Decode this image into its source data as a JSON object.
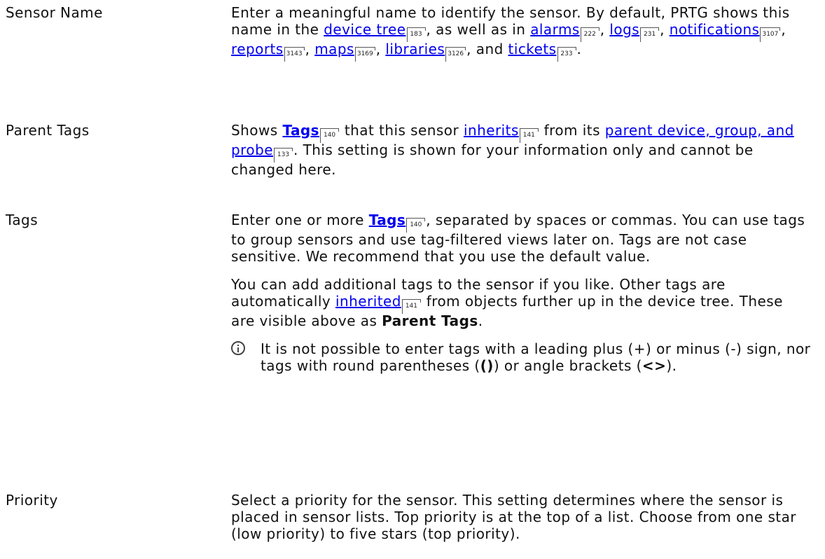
{
  "settings": [
    {
      "label": "Sensor Name",
      "paragraphs": [
        {
          "segments": [
            {
              "t": "Enter a meaningful name to identify the sensor. By default, PRTG shows this name in the "
            },
            {
              "t": "device tree",
              "link": true,
              "page": "183"
            },
            {
              "t": ", as well as in "
            },
            {
              "t": "alarms",
              "link": true,
              "page": "222"
            },
            {
              "t": ", "
            },
            {
              "t": "logs",
              "link": true,
              "page": "231"
            },
            {
              "t": ", "
            },
            {
              "t": "notifications",
              "link": true,
              "page": "3107"
            },
            {
              "t": ", "
            },
            {
              "t": "reports",
              "link": true,
              "page": "3143"
            },
            {
              "t": ", "
            },
            {
              "t": "maps",
              "link": true,
              "page": "3169"
            },
            {
              "t": ", "
            },
            {
              "t": "libraries",
              "link": true,
              "page": "3126"
            },
            {
              "t": ", and "
            },
            {
              "t": "tickets",
              "link": true,
              "page": "233"
            },
            {
              "t": "."
            }
          ]
        }
      ]
    },
    {
      "label": "Parent Tags",
      "paragraphs": [
        {
          "segments": [
            {
              "t": "Shows "
            },
            {
              "t": "Tags",
              "link": true,
              "bold": true,
              "page": "140"
            },
            {
              "t": " that this sensor "
            },
            {
              "t": "inherits",
              "link": true,
              "page": "141"
            },
            {
              "t": " from its "
            },
            {
              "t": "parent device, group, and probe",
              "link": true,
              "page": "133"
            },
            {
              "t": ". This setting is shown for your information only and cannot be changed here."
            }
          ]
        }
      ]
    },
    {
      "label": "Tags",
      "paragraphs": [
        {
          "segments": [
            {
              "t": "Enter one or more "
            },
            {
              "t": "Tags",
              "link": true,
              "bold": true,
              "page": "140"
            },
            {
              "t": ", separated by spaces or commas. You can use tags to group sensors and use tag-filtered views later on. Tags are not case sensitive. We recommend that you use the default value."
            }
          ]
        },
        {
          "segments": [
            {
              "t": "You can add additional tags to the sensor if you like. Other tags are automatically "
            },
            {
              "t": "inherited",
              "link": true,
              "page": "141"
            },
            {
              "t": " from objects further up in the device tree. These are visible above as "
            },
            {
              "t": "Parent Tags",
              "bold": true
            },
            {
              "t": "."
            }
          ]
        },
        {
          "info": true,
          "segments": [
            {
              "t": "It is not possible to enter tags with a leading plus (+) or minus (-) sign, nor tags with round parentheses ("
            },
            {
              "t": "()",
              "bold": true
            },
            {
              "t": ") or angle brackets ("
            },
            {
              "t": "<>",
              "bold": true
            },
            {
              "t": ")."
            }
          ]
        }
      ]
    },
    {
      "label": "Priority",
      "paragraphs": [
        {
          "segments": [
            {
              "t": "Select a priority for the sensor. This setting determines where the sensor is placed in sensor lists. Top priority is at the top of a list. Choose from one star (low priority) to five stars (top priority)."
            }
          ]
        }
      ]
    }
  ]
}
